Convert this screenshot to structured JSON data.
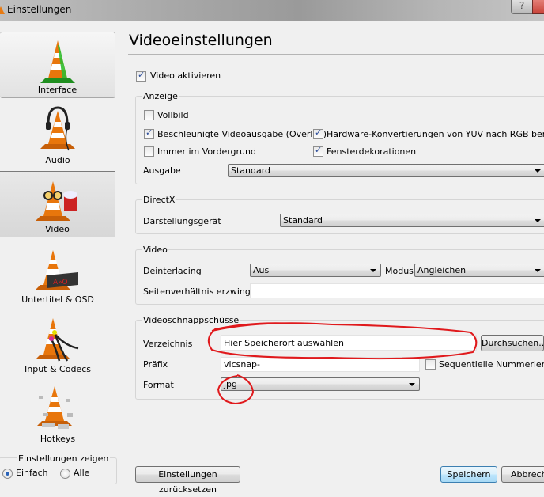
{
  "window": {
    "title": "Einstellungen",
    "help_label": "?"
  },
  "sidebar": {
    "items": [
      {
        "label": "Interface",
        "icon": "vlc-cone-interface-icon"
      },
      {
        "label": "Audio",
        "icon": "vlc-cone-headphones-icon"
      },
      {
        "label": "Video",
        "icon": "vlc-cone-glasses-popcorn-icon",
        "selected": true
      },
      {
        "label": "Untertitel & OSD",
        "icon": "vlc-cone-display-icon"
      },
      {
        "label": "Input & Codecs",
        "icon": "vlc-cone-cables-icon"
      },
      {
        "label": "Hotkeys",
        "icon": "vlc-cone-keys-icon"
      }
    ],
    "show_settings": {
      "label": "Einstellungen zeigen",
      "options": [
        {
          "label": "Einfach",
          "selected": true
        },
        {
          "label": "Alle",
          "selected": false
        }
      ]
    }
  },
  "main": {
    "title": "Videoeinstellungen",
    "enable_video": {
      "label": "Video aktivieren",
      "checked": true
    },
    "display": {
      "legend": "Anzeige",
      "fullscreen": {
        "label": "Vollbild",
        "checked": false
      },
      "overlay": {
        "label": "Beschleunigte Videoausgabe (Overlay)",
        "checked": true
      },
      "yuv_rgb": {
        "label": "Hardware-Konvertierungen von YUV nach RGB benutzen",
        "checked": true
      },
      "always_on_top": {
        "label": "Immer im Vordergrund",
        "checked": false
      },
      "window_decorations": {
        "label": "Fensterdekorationen",
        "checked": true
      },
      "output_label": "Ausgabe",
      "output_value": "Standard"
    },
    "directx": {
      "legend": "DirectX",
      "device_label": "Darstellungsgerät",
      "device_value": "Standard"
    },
    "video": {
      "legend": "Video",
      "deinterlacing_label": "Deinterlacing",
      "deinterlacing_value": "Aus",
      "mode_label": "Modus",
      "mode_value": "Angleichen",
      "aspect_label": "Seitenverhältnis erzwingen",
      "aspect_value": ""
    },
    "snapshots": {
      "legend": "Videoschnappschüsse",
      "directory_label": "Verzeichnis",
      "directory_value": "Hier Speicherort auswählen",
      "browse_label": "Durchsuchen...",
      "prefix_label": "Präfix",
      "prefix_value": "vlcsnap-",
      "sequential_label": "Sequentielle Nummerierung",
      "sequential_checked": false,
      "format_label": "Format",
      "format_value": "jpg"
    }
  },
  "footer": {
    "reset_label": "Einstellungen zurücksetzen",
    "save_label": "Speichern",
    "cancel_label": "Abbrechen"
  },
  "annotations": {
    "color": "#e0191c"
  }
}
